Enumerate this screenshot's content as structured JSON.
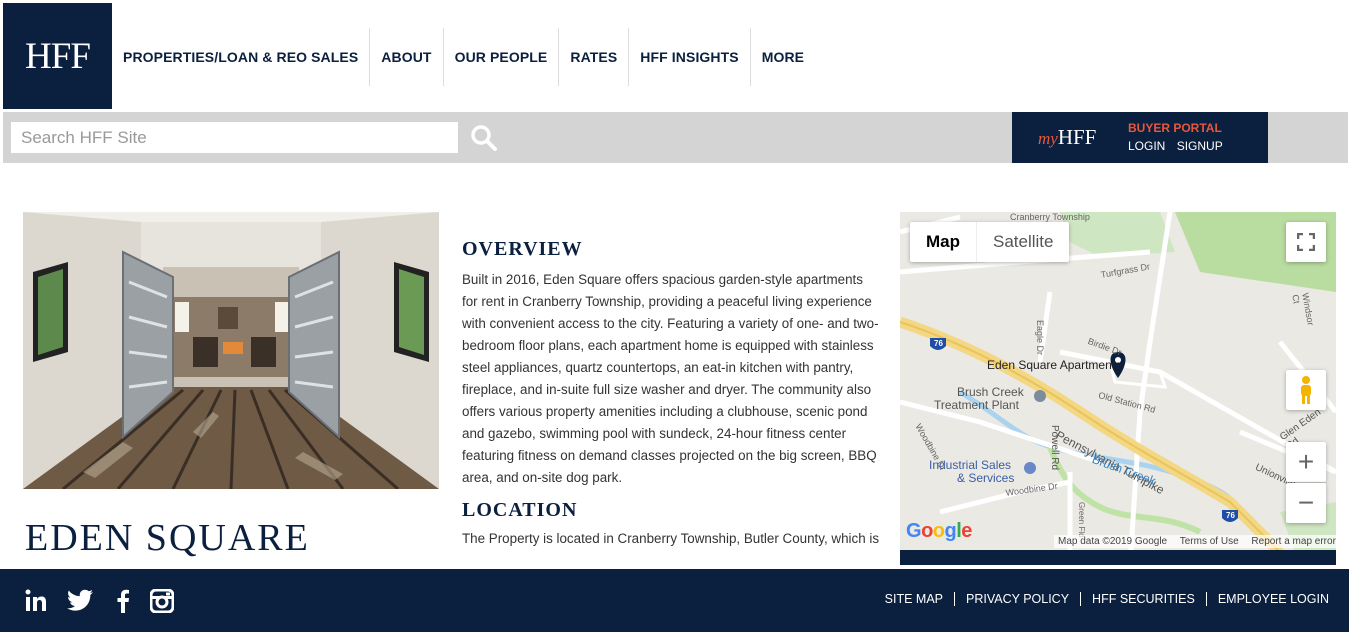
{
  "brand": {
    "logo_text": "HFF",
    "navy": "#0b1f3f",
    "accent": "#e8573c"
  },
  "nav": {
    "items": [
      {
        "label": "PROPERTIES/LOAN & REO SALES"
      },
      {
        "label": "ABOUT"
      },
      {
        "label": "OUR PEOPLE"
      },
      {
        "label": "RATES"
      },
      {
        "label": "HFF INSIGHTS"
      },
      {
        "label": "MORE"
      }
    ]
  },
  "search": {
    "placeholder": "Search HFF Site",
    "icon": "search-icon"
  },
  "portal": {
    "brand_prefix": "my",
    "brand_name": "HFF",
    "title": "BUYER PORTAL",
    "login": "LOGIN",
    "signup": "SIGNUP"
  },
  "property": {
    "title": "EDEN SQUARE APARTMENTS"
  },
  "overview": {
    "heading": "OVERVIEW",
    "text": "Built in 2016, Eden Square offers spacious garden-style apartments for rent in Cranberry Township, providing a peaceful living experience with convenient access to the city. Featuring a variety of one- and two- bedroom floor plans, each apartment home is equipped with stainless steel appliances, quartz countertops, an eat-in kitchen with pantry, fireplace, and in-suite full size washer and dryer. The community also offers various property amenities including a clubhouse, scenic pond and gazebo, swimming pool with sundeck, 24-hour fitness center featuring fitness on demand classes projected on the big screen, BBQ area, and on-site dog park."
  },
  "location": {
    "heading": "LOCATION",
    "text": "The Property is located in Cranberry Township, Butler County, which is one of the fastest growing municipalities in the state of"
  },
  "map": {
    "tab_map": "Map",
    "tab_satellite": "Satellite",
    "labels": {
      "eden": "Eden Square Apartments",
      "brush": "Brush Creek",
      "treatment": "Treatment Plant",
      "industrial": "Industrial Sales",
      "services": "& Services",
      "turnpike": "Pennsylvania Turnpike",
      "brushcreek": "Brush Creek",
      "powell": "Powell Rd",
      "oldstation": "Old Station Rd",
      "birdie": "Birdie Dr",
      "eagle": "Eagle Dr",
      "turfgrass": "Turfgrass Dr",
      "woodbine": "Woodbine Dr",
      "woodbine2": "Woodbine Dr",
      "gleneden": "Glen Eden Rd",
      "unionville": "Unionville",
      "windsor": "Windsor Ct",
      "green": "Green Fld",
      "township": "Cranberry Township",
      "route76a": "76",
      "route76b": "76"
    },
    "logo": "Google",
    "map_data": "Map data ©2019 Google",
    "terms": "Terms of Use",
    "report": "Report a map error"
  },
  "footer": {
    "social": [
      "linkedin-icon",
      "twitter-icon",
      "facebook-icon",
      "instagram-icon"
    ],
    "links": [
      {
        "label": "SITE MAP"
      },
      {
        "label": "PRIVACY POLICY"
      },
      {
        "label": "HFF SECURITIES"
      },
      {
        "label": "EMPLOYEE LOGIN"
      }
    ]
  }
}
